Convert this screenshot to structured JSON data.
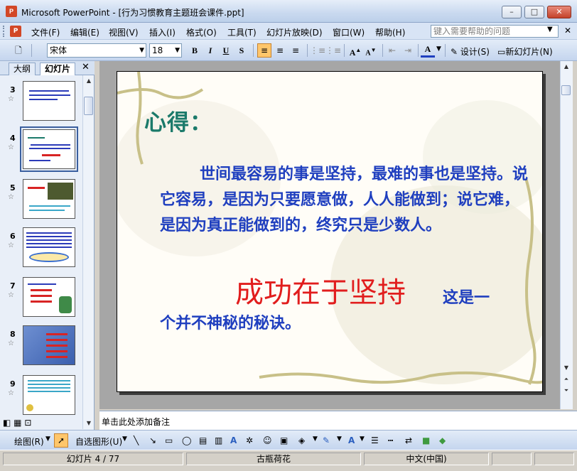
{
  "app": {
    "title": "Microsoft PowerPoint - [行为习惯教育主题班会课件.ppt]",
    "icon_label": "P",
    "window_buttons": [
      "minimize-icon",
      "maximize-icon",
      "close-icon"
    ]
  },
  "menubar": {
    "items": [
      "文件(F)",
      "编辑(E)",
      "视图(V)",
      "插入(I)",
      "格式(O)",
      "工具(T)",
      "幻灯片放映(D)",
      "窗口(W)",
      "帮助(H)"
    ],
    "help_placeholder": "键入需要帮助的问题"
  },
  "toolbar": {
    "font_name": "宋体",
    "font_size": "18",
    "bold": "B",
    "italic": "I",
    "underline": "U",
    "shadow": "S",
    "design_label": "设计(S)",
    "new_slide_label": "新幻灯片(N)"
  },
  "left_pane": {
    "tabs": [
      "大纲",
      "幻灯片"
    ],
    "selected_tab": "幻灯片",
    "thumbnails": [
      {
        "number": "3"
      },
      {
        "number": "4"
      },
      {
        "number": "5"
      },
      {
        "number": "6"
      },
      {
        "number": "7"
      },
      {
        "number": "8"
      },
      {
        "number": "9"
      }
    ],
    "selected_slide": "4"
  },
  "slide": {
    "title": "心得：",
    "body": "世间最容易的事是坚持，最难的事也是坚持。说它容易，是因为只要愿意做，人人能做到；说它难，是因为真正能做到的，终究只是少数人。",
    "highlight": "成功在于坚持",
    "after_highlight": "这是一",
    "tail": "个并不神秘的秘诀。",
    "colors": {
      "title": "#1b7a6a",
      "body": "#1f3fbf",
      "highlight": "#e11d1d"
    }
  },
  "notes": {
    "placeholder": "单击此处添加备注"
  },
  "drawing_toolbar": {
    "draw_label": "绘图(R)",
    "autoshapes_label": "自选图形(U)"
  },
  "status": {
    "slide_info": "幻灯片 4 / 77",
    "design": "古瓶荷花",
    "language": "中文(中国)"
  }
}
